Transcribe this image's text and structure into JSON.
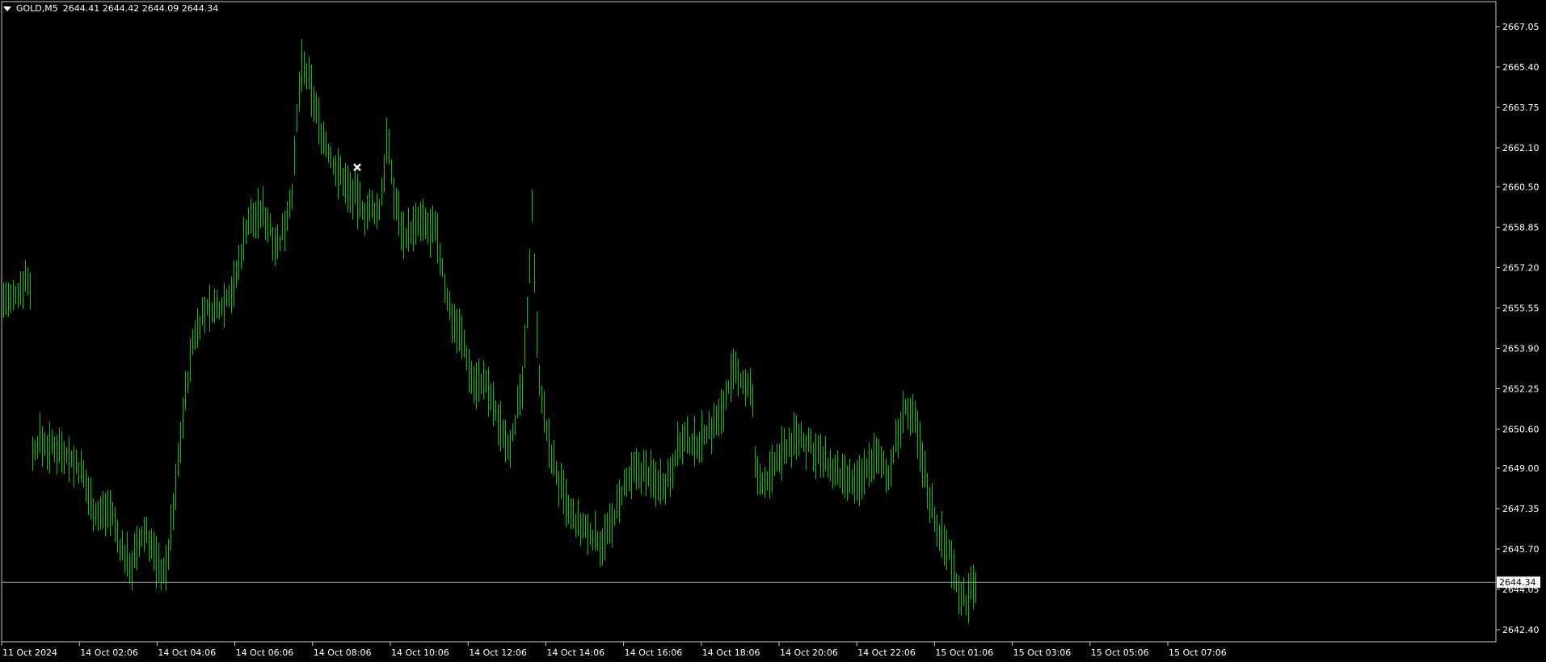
{
  "header": {
    "symbol": "GOLD,M5",
    "ohlc": "2644.41 2644.42 2644.09 2644.34"
  },
  "colors": {
    "background": "#000000",
    "bars": "#00c800",
    "frame": "#c8c8c8",
    "text": "#ffffff",
    "bid_line": "#a0a0a0"
  },
  "chart_data": {
    "type": "ohlc",
    "symbol": "GOLD",
    "timeframe": "M5",
    "grid": false,
    "last_price": "2644.34",
    "ylim": [
      2641.9,
      2667.7
    ],
    "y_ticks": [
      "2667.05",
      "2665.40",
      "2663.75",
      "2662.10",
      "2660.50",
      "2658.85",
      "2657.20",
      "2655.55",
      "2653.90",
      "2652.25",
      "2650.60",
      "2649.00",
      "2647.35",
      "2645.70",
      "2644.05",
      "2642.40"
    ],
    "x_ticks": [
      "11 Oct 2024",
      "14 Oct 02:06",
      "14 Oct 04:06",
      "14 Oct 06:06",
      "14 Oct 08:06",
      "14 Oct 10:06",
      "14 Oct 12:06",
      "14 Oct 14:06",
      "14 Oct 16:06",
      "14 Oct 18:06",
      "14 Oct 20:06",
      "14 Oct 22:06",
      "15 Oct 01:06",
      "15 Oct 03:06",
      "15 Oct 05:06",
      "15 Oct 07:06"
    ],
    "price_path": [
      [
        0,
        2655.8
      ],
      [
        8,
        2656.0
      ],
      [
        12,
        2655.6
      ],
      [
        22,
        2656.2
      ],
      [
        30,
        2656.8
      ],
      [
        38,
        2656.5
      ],
      [
        40,
        2649.5
      ],
      [
        48,
        2650.2
      ],
      [
        60,
        2649.8
      ],
      [
        75,
        2649.9
      ],
      [
        100,
        2648.8
      ],
      [
        120,
        2647.0
      ],
      [
        135,
        2647.5
      ],
      [
        148,
        2645.8
      ],
      [
        162,
        2645.0
      ],
      [
        180,
        2646.5
      ],
      [
        195,
        2645.0
      ],
      [
        205,
        2644.8
      ],
      [
        215,
        2647.5
      ],
      [
        225,
        2651.0
      ],
      [
        240,
        2654.5
      ],
      [
        255,
        2655.5
      ],
      [
        270,
        2655.5
      ],
      [
        290,
        2656.5
      ],
      [
        305,
        2659.0
      ],
      [
        325,
        2659.5
      ],
      [
        345,
        2658.0
      ],
      [
        362,
        2660.5
      ],
      [
        372,
        2665.5
      ],
      [
        385,
        2664.5
      ],
      [
        395,
        2663.0
      ],
      [
        410,
        2661.5
      ],
      [
        430,
        2660.5
      ],
      [
        450,
        2659.5
      ],
      [
        470,
        2659.5
      ],
      [
        478,
        2662.5
      ],
      [
        488,
        2660.0
      ],
      [
        500,
        2658.5
      ],
      [
        520,
        2659.0
      ],
      [
        540,
        2658.5
      ],
      [
        555,
        2655.5
      ],
      [
        570,
        2654.5
      ],
      [
        585,
        2652.5
      ],
      [
        600,
        2652.5
      ],
      [
        615,
        2651.0
      ],
      [
        630,
        2650.0
      ],
      [
        645,
        2652.0
      ],
      [
        652,
        2655.0
      ],
      [
        658,
        2660.0
      ],
      [
        665,
        2653.5
      ],
      [
        675,
        2650.5
      ],
      [
        690,
        2648.5
      ],
      [
        705,
        2647.0
      ],
      [
        720,
        2646.5
      ],
      [
        742,
        2646.0
      ],
      [
        755,
        2646.5
      ],
      [
        770,
        2648.0
      ],
      [
        790,
        2649.0
      ],
      [
        810,
        2648.5
      ],
      [
        825,
        2648.5
      ],
      [
        840,
        2650.0
      ],
      [
        860,
        2650.0
      ],
      [
        875,
        2650.5
      ],
      [
        890,
        2651.0
      ],
      [
        905,
        2652.8
      ],
      [
        920,
        2652.5
      ],
      [
        930,
        2652.2
      ],
      [
        935,
        2648.5
      ],
      [
        950,
        2648.5
      ],
      [
        965,
        2649.5
      ],
      [
        985,
        2650.3
      ],
      [
        1005,
        2649.8
      ],
      [
        1020,
        2649.2
      ],
      [
        1040,
        2648.5
      ],
      [
        1060,
        2648.3
      ],
      [
        1080,
        2649.5
      ],
      [
        1100,
        2648.8
      ],
      [
        1112,
        2650.5
      ],
      [
        1120,
        2651.5
      ],
      [
        1135,
        2650.5
      ],
      [
        1145,
        2648.5
      ],
      [
        1160,
        2646.5
      ],
      [
        1175,
        2645.5
      ],
      [
        1185,
        2644.2
      ],
      [
        1195,
        2643.5
      ],
      [
        1207,
        2644.34
      ]
    ]
  }
}
